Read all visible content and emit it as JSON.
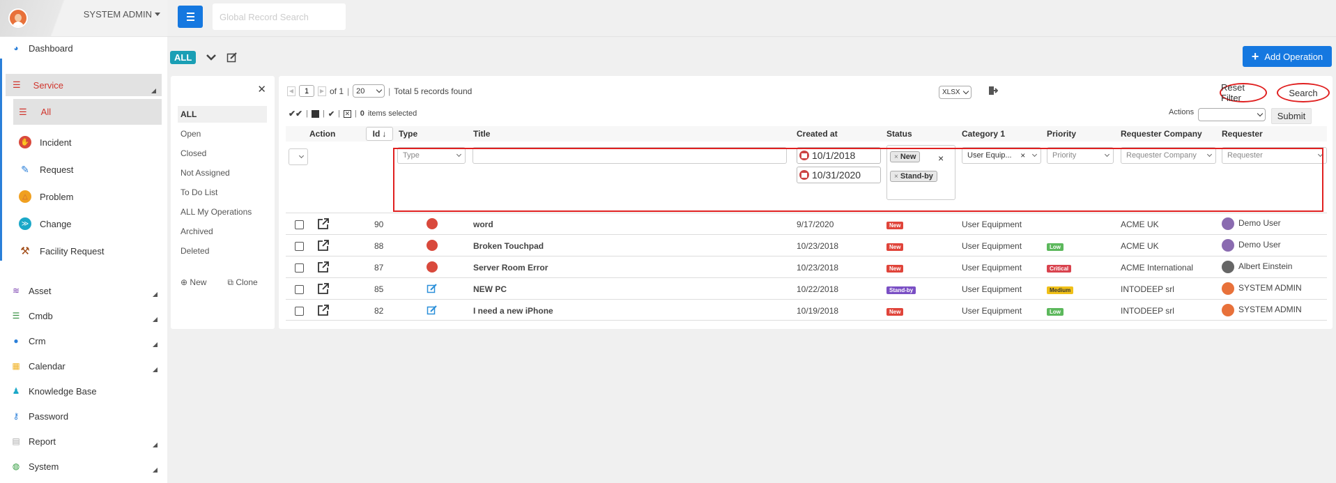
{
  "sidebar": {
    "user": "SYSTEM ADMIN",
    "items": [
      {
        "label": "Dashboard",
        "icon": "dashboard-icon"
      },
      {
        "label": "Service",
        "icon": "service-list-icon"
      },
      {
        "label": "All",
        "icon": "list-icon"
      },
      {
        "label": "Incident",
        "icon": "incident-icon"
      },
      {
        "label": "Request",
        "icon": "request-icon"
      },
      {
        "label": "Problem",
        "icon": "problem-icon"
      },
      {
        "label": "Change",
        "icon": "change-icon"
      },
      {
        "label": "Facility Request",
        "icon": "hammer-icon"
      },
      {
        "label": "Asset",
        "icon": "wifi-icon"
      },
      {
        "label": "Cmdb",
        "icon": "database-icon"
      },
      {
        "label": "Crm",
        "icon": "user-icon"
      },
      {
        "label": "Calendar",
        "icon": "calendar-icon"
      },
      {
        "label": "Knowledge Base",
        "icon": "reader-icon"
      },
      {
        "label": "Password",
        "icon": "key-icon"
      },
      {
        "label": "Report",
        "icon": "document-icon"
      },
      {
        "label": "System",
        "icon": "globe-icon"
      }
    ]
  },
  "topbar": {
    "search_placeholder": "Global Record Search"
  },
  "toolbar": {
    "all_label": "ALL",
    "add_operation": "Add Operation"
  },
  "filters": {
    "items": [
      "ALL",
      "Open",
      "Closed",
      "Not Assigned",
      "To Do List",
      "ALL My Operations",
      "Archived",
      "Deleted"
    ],
    "new_label": "New",
    "clone_label": "Clone"
  },
  "pager": {
    "page": "1",
    "of": "of 1",
    "page_size": "20",
    "total": "Total 5 records found",
    "export_format": "XLSX"
  },
  "buttons": {
    "reset_filter": "Reset Filter",
    "search": "Search",
    "submit": "Submit",
    "actions_label": "Actions"
  },
  "bulk": {
    "selected_count": "0",
    "selected_text": "items selected"
  },
  "table": {
    "headers": {
      "action": "Action",
      "id": "Id",
      "type": "Type",
      "title": "Title",
      "created": "Created at",
      "status": "Status",
      "category": "Category 1",
      "priority": "Priority",
      "company": "Requester Company",
      "requester": "Requester"
    },
    "filter": {
      "type_placeholder": "Type",
      "date_from": "10/1/2018",
      "date_to": "10/31/2020",
      "status_tags": [
        "New",
        "Stand-by"
      ],
      "category_value": "User Equip...",
      "priority_placeholder": "Priority",
      "company_placeholder": "Requester Company",
      "requester_placeholder": "Requester"
    },
    "rows": [
      {
        "id": "90",
        "type": "incident",
        "title": "word",
        "created": "9/17/2020",
        "status": "New",
        "category": "User Equipment",
        "priority": "",
        "company": "ACME UK",
        "requester": "Demo User"
      },
      {
        "id": "88",
        "type": "incident",
        "title": "Broken Touchpad",
        "created": "10/23/2018",
        "status": "New",
        "category": "User Equipment",
        "priority": "Low",
        "company": "ACME UK",
        "requester": "Demo User"
      },
      {
        "id": "87",
        "type": "incident",
        "title": "Server Room Error",
        "created": "10/23/2018",
        "status": "New",
        "category": "User Equipment",
        "priority": "Critical",
        "company": "ACME International",
        "requester": "Albert Einstein"
      },
      {
        "id": "85",
        "type": "request",
        "title": "NEW PC",
        "created": "10/22/2018",
        "status": "Stand-by",
        "category": "User Equipment",
        "priority": "Medium",
        "company": "INTODEEP srl",
        "requester": "SYSTEM ADMIN"
      },
      {
        "id": "82",
        "type": "request",
        "title": "I need a new iPhone",
        "created": "10/19/2018",
        "status": "New",
        "category": "User Equipment",
        "priority": "Low",
        "company": "INTODEEP srl",
        "requester": "SYSTEM ADMIN"
      }
    ]
  },
  "colors": {
    "accent": "#1578e0",
    "status_new": "#e0443a",
    "status_standby": "#7a4fc4",
    "priority_low": "#5cb85c",
    "priority_critical": "#d9434e",
    "priority_medium": "#f0c018",
    "highlight": "#e02020"
  }
}
